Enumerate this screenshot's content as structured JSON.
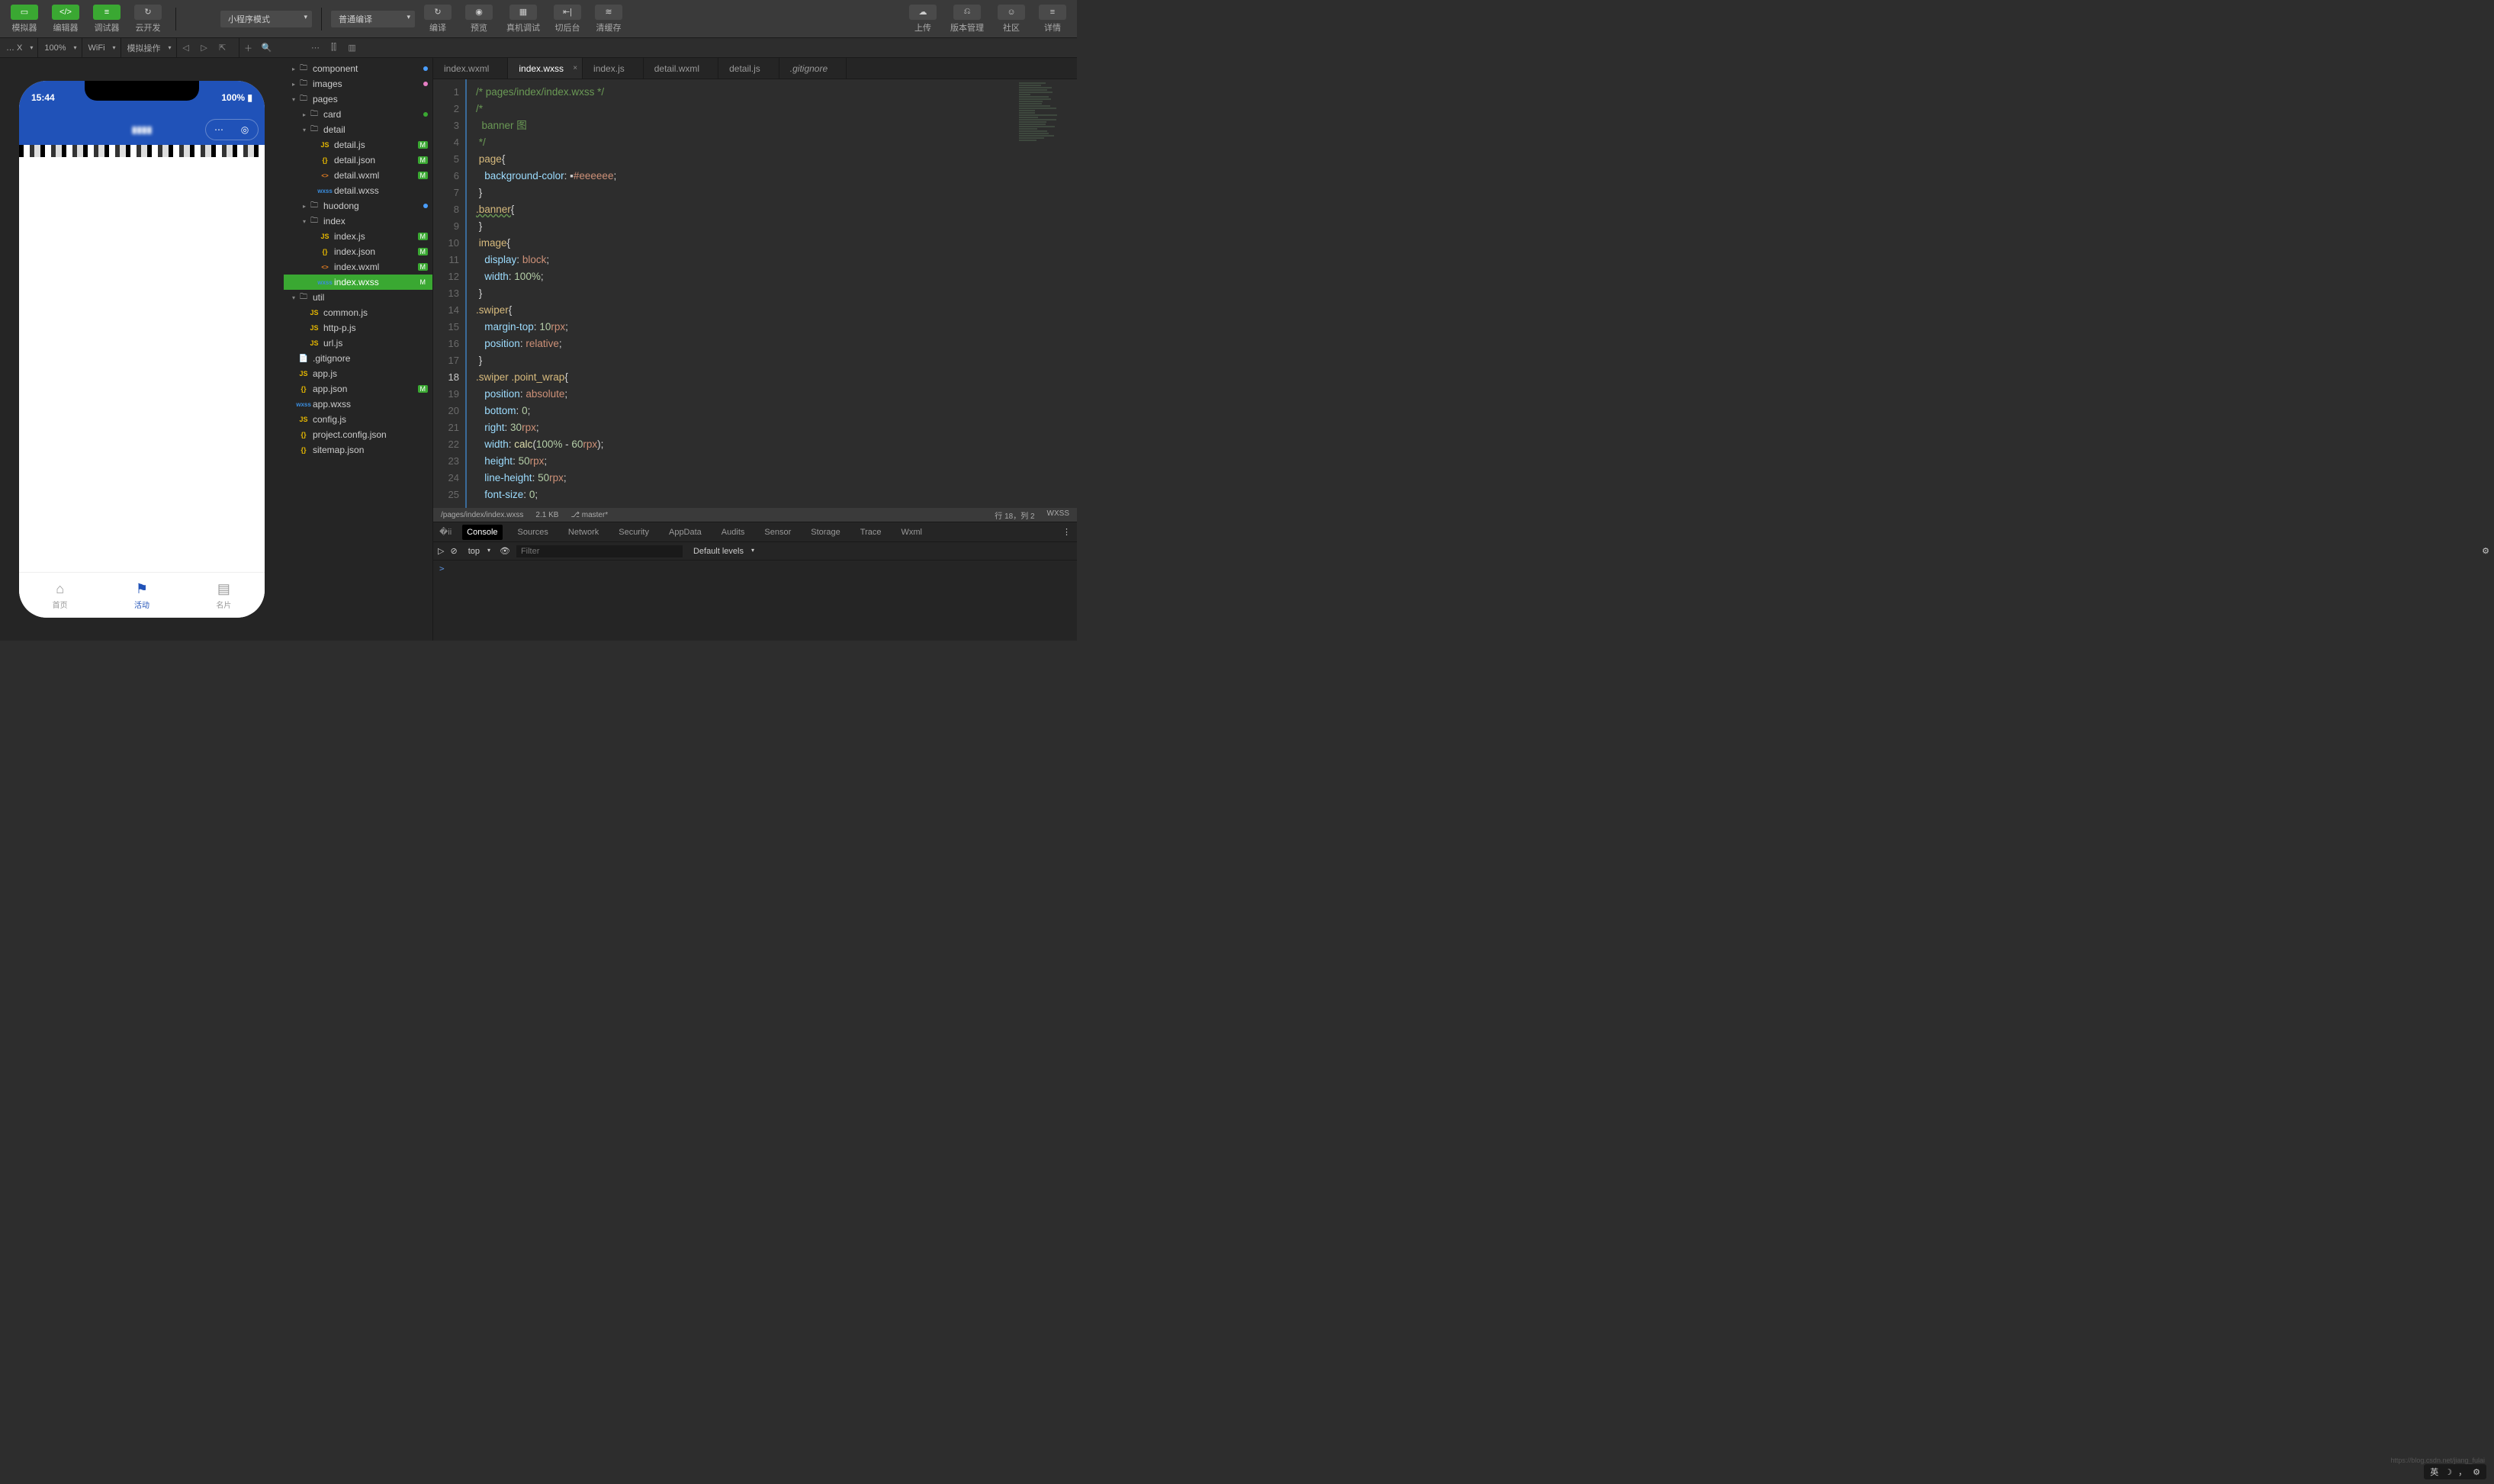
{
  "toolbar": {
    "simulator": "模拟器",
    "editor": "编辑器",
    "debugger": "调试器",
    "cloud": "云开发",
    "mode": "小程序模式",
    "compile_mode": "普通编译",
    "compile": "编译",
    "preview": "预览",
    "remote": "真机调试",
    "switch": "切后台",
    "clear": "清缓存",
    "upload": "上传",
    "version": "版本管理",
    "community": "社区",
    "detail": "详情"
  },
  "subbar": {
    "device": "… X",
    "zoom": "100%",
    "network": "WiFi",
    "mock": "模拟操作"
  },
  "phone": {
    "time": "15:44",
    "battery": "100%",
    "title": "▮▮▮▮",
    "tabs": [
      {
        "label": "首页"
      },
      {
        "label": "活动"
      },
      {
        "label": "名片"
      }
    ]
  },
  "tree": [
    {
      "d": 0,
      "arrow": "▸",
      "ico": "folder",
      "name": "component",
      "dot": "blue"
    },
    {
      "d": 0,
      "arrow": "▸",
      "ico": "folder",
      "name": "images",
      "dot": "pink"
    },
    {
      "d": 0,
      "arrow": "▾",
      "ico": "folder",
      "name": "pages"
    },
    {
      "d": 1,
      "arrow": "▸",
      "ico": "folder",
      "name": "card",
      "dot": "green"
    },
    {
      "d": 1,
      "arrow": "▾",
      "ico": "folder",
      "name": "detail"
    },
    {
      "d": 2,
      "ico": "js",
      "name": "detail.js",
      "m": true
    },
    {
      "d": 2,
      "ico": "json",
      "name": "detail.json",
      "m": true
    },
    {
      "d": 2,
      "ico": "wxml",
      "name": "detail.wxml",
      "m": true
    },
    {
      "d": 2,
      "ico": "wxss",
      "name": "detail.wxss"
    },
    {
      "d": 1,
      "arrow": "▸",
      "ico": "folder",
      "name": "huodong",
      "dot": "blue"
    },
    {
      "d": 1,
      "arrow": "▾",
      "ico": "folder",
      "name": "index"
    },
    {
      "d": 2,
      "ico": "js",
      "name": "index.js",
      "m": true
    },
    {
      "d": 2,
      "ico": "json",
      "name": "index.json",
      "m": true
    },
    {
      "d": 2,
      "ico": "wxml",
      "name": "index.wxml",
      "m": true
    },
    {
      "d": 2,
      "ico": "wxss",
      "name": "index.wxss",
      "m": true,
      "sel": true
    },
    {
      "d": 0,
      "arrow": "▾",
      "ico": "folder",
      "name": "util"
    },
    {
      "d": 1,
      "ico": "js",
      "name": "common.js"
    },
    {
      "d": 1,
      "ico": "js",
      "name": "http-p.js"
    },
    {
      "d": 1,
      "ico": "js",
      "name": "url.js"
    },
    {
      "d": 0,
      "ico": "file",
      "name": ".gitignore"
    },
    {
      "d": 0,
      "ico": "js",
      "name": "app.js"
    },
    {
      "d": 0,
      "ico": "json",
      "name": "app.json",
      "m": true
    },
    {
      "d": 0,
      "ico": "wxss",
      "name": "app.wxss"
    },
    {
      "d": 0,
      "ico": "js",
      "name": "config.js"
    },
    {
      "d": 0,
      "ico": "json",
      "name": "project.config.json"
    },
    {
      "d": 0,
      "ico": "json",
      "name": "sitemap.json"
    }
  ],
  "tabs": [
    {
      "label": "index.wxml"
    },
    {
      "label": "index.wxss",
      "active": true,
      "close": true
    },
    {
      "label": "index.js"
    },
    {
      "label": "detail.wxml"
    },
    {
      "label": "detail.js"
    },
    {
      "label": ".gitignore",
      "italic": true
    }
  ],
  "code": [
    [
      {
        "t": "/* pages/index/index.wxss */",
        "c": "comment"
      }
    ],
    [
      {
        "t": "/*",
        "c": "comment"
      }
    ],
    [
      {
        "t": "  banner 图",
        "c": "comment"
      }
    ],
    [
      {
        "t": " */",
        "c": "comment"
      }
    ],
    [
      {
        "t": " ",
        "c": ""
      },
      {
        "t": "page",
        "c": "sel"
      },
      {
        "t": "{",
        "c": "punc"
      }
    ],
    [
      {
        "t": "   ",
        "c": ""
      },
      {
        "t": "background-color",
        "c": "prop"
      },
      {
        "t": ": ",
        "c": "punc"
      },
      {
        "t": "▪",
        "c": "punc"
      },
      {
        "t": "#eeeeee",
        "c": "val"
      },
      {
        "t": ";",
        "c": "punc"
      }
    ],
    [
      {
        "t": " }",
        "c": "punc"
      }
    ],
    [
      {
        "t": ".banner",
        "c": "sel-u"
      },
      {
        "t": "{",
        "c": "punc"
      }
    ],
    [
      {
        "t": "",
        "c": ""
      }
    ],
    [
      {
        "t": " }",
        "c": "punc"
      }
    ],
    [
      {
        "t": " ",
        "c": ""
      },
      {
        "t": "image",
        "c": "sel"
      },
      {
        "t": "{",
        "c": "punc"
      }
    ],
    [
      {
        "t": "   ",
        "c": ""
      },
      {
        "t": "display",
        "c": "prop"
      },
      {
        "t": ": ",
        "c": "punc"
      },
      {
        "t": "block",
        "c": "val"
      },
      {
        "t": ";",
        "c": "punc"
      }
    ],
    [
      {
        "t": "   ",
        "c": ""
      },
      {
        "t": "width",
        "c": "prop"
      },
      {
        "t": ": ",
        "c": "punc"
      },
      {
        "t": "100%",
        "c": "num"
      },
      {
        "t": ";",
        "c": "punc"
      }
    ],
    [
      {
        "t": " }",
        "c": "punc"
      }
    ],
    [
      {
        "t": ".swiper",
        "c": "sel"
      },
      {
        "t": "{",
        "c": "punc"
      }
    ],
    [
      {
        "t": "   ",
        "c": ""
      },
      {
        "t": "margin-top",
        "c": "prop"
      },
      {
        "t": ": ",
        "c": "punc"
      },
      {
        "t": "10",
        "c": "num"
      },
      {
        "t": "rpx",
        "c": "val"
      },
      {
        "t": ";",
        "c": "punc"
      }
    ],
    [
      {
        "t": "   ",
        "c": ""
      },
      {
        "t": "position",
        "c": "prop"
      },
      {
        "t": ": ",
        "c": "punc"
      },
      {
        "t": "relative",
        "c": "val"
      },
      {
        "t": ";",
        "c": "punc"
      }
    ],
    [
      {
        "t": " }",
        "c": "punc",
        "cur": true
      }
    ],
    [
      {
        "t": ".swiper .point_wrap",
        "c": "sel"
      },
      {
        "t": "{",
        "c": "punc"
      }
    ],
    [
      {
        "t": "   ",
        "c": ""
      },
      {
        "t": "position",
        "c": "prop"
      },
      {
        "t": ": ",
        "c": "punc"
      },
      {
        "t": "absolute",
        "c": "val"
      },
      {
        "t": ";",
        "c": "punc"
      }
    ],
    [
      {
        "t": "   ",
        "c": ""
      },
      {
        "t": "bottom",
        "c": "prop"
      },
      {
        "t": ": ",
        "c": "punc"
      },
      {
        "t": "0",
        "c": "num"
      },
      {
        "t": ";",
        "c": "punc"
      }
    ],
    [
      {
        "t": "   ",
        "c": ""
      },
      {
        "t": "right",
        "c": "prop"
      },
      {
        "t": ": ",
        "c": "punc"
      },
      {
        "t": "30",
        "c": "num"
      },
      {
        "t": "rpx",
        "c": "val"
      },
      {
        "t": ";",
        "c": "punc"
      }
    ],
    [
      {
        "t": "   ",
        "c": ""
      },
      {
        "t": "width",
        "c": "prop"
      },
      {
        "t": ": ",
        "c": "punc"
      },
      {
        "t": "calc",
        "c": "func"
      },
      {
        "t": "(",
        "c": "punc"
      },
      {
        "t": "100%",
        "c": "num"
      },
      {
        "t": " - ",
        "c": "punc"
      },
      {
        "t": "60",
        "c": "num"
      },
      {
        "t": "rpx",
        "c": "val"
      },
      {
        "t": ");",
        "c": "punc"
      }
    ],
    [
      {
        "t": "   ",
        "c": ""
      },
      {
        "t": "height",
        "c": "prop"
      },
      {
        "t": ": ",
        "c": "punc"
      },
      {
        "t": "50",
        "c": "num"
      },
      {
        "t": "rpx",
        "c": "val"
      },
      {
        "t": ";",
        "c": "punc"
      }
    ],
    [
      {
        "t": "   ",
        "c": ""
      },
      {
        "t": "line-height",
        "c": "prop"
      },
      {
        "t": ": ",
        "c": "punc"
      },
      {
        "t": "50",
        "c": "num"
      },
      {
        "t": "rpx",
        "c": "val"
      },
      {
        "t": ";",
        "c": "punc"
      }
    ],
    [
      {
        "t": "   ",
        "c": ""
      },
      {
        "t": "font-size",
        "c": "prop"
      },
      {
        "t": ": ",
        "c": "punc"
      },
      {
        "t": "0",
        "c": "num"
      },
      {
        "t": ";",
        "c": "punc"
      }
    ]
  ],
  "status": {
    "path": "/pages/index/index.wxss",
    "size": "2.1 KB",
    "branch": "master*",
    "pos": "行 18，列 2",
    "lang": "WXSS"
  },
  "devtools": {
    "tabs": [
      "Console",
      "Sources",
      "Network",
      "Security",
      "AppData",
      "Audits",
      "Sensor",
      "Storage",
      "Trace",
      "Wxml"
    ],
    "context": "top",
    "filter_ph": "Filter",
    "levels": "Default levels",
    "prompt": ">"
  },
  "ime": "英",
  "watermark": "https://blog.csdn.net/jiang_fulai"
}
